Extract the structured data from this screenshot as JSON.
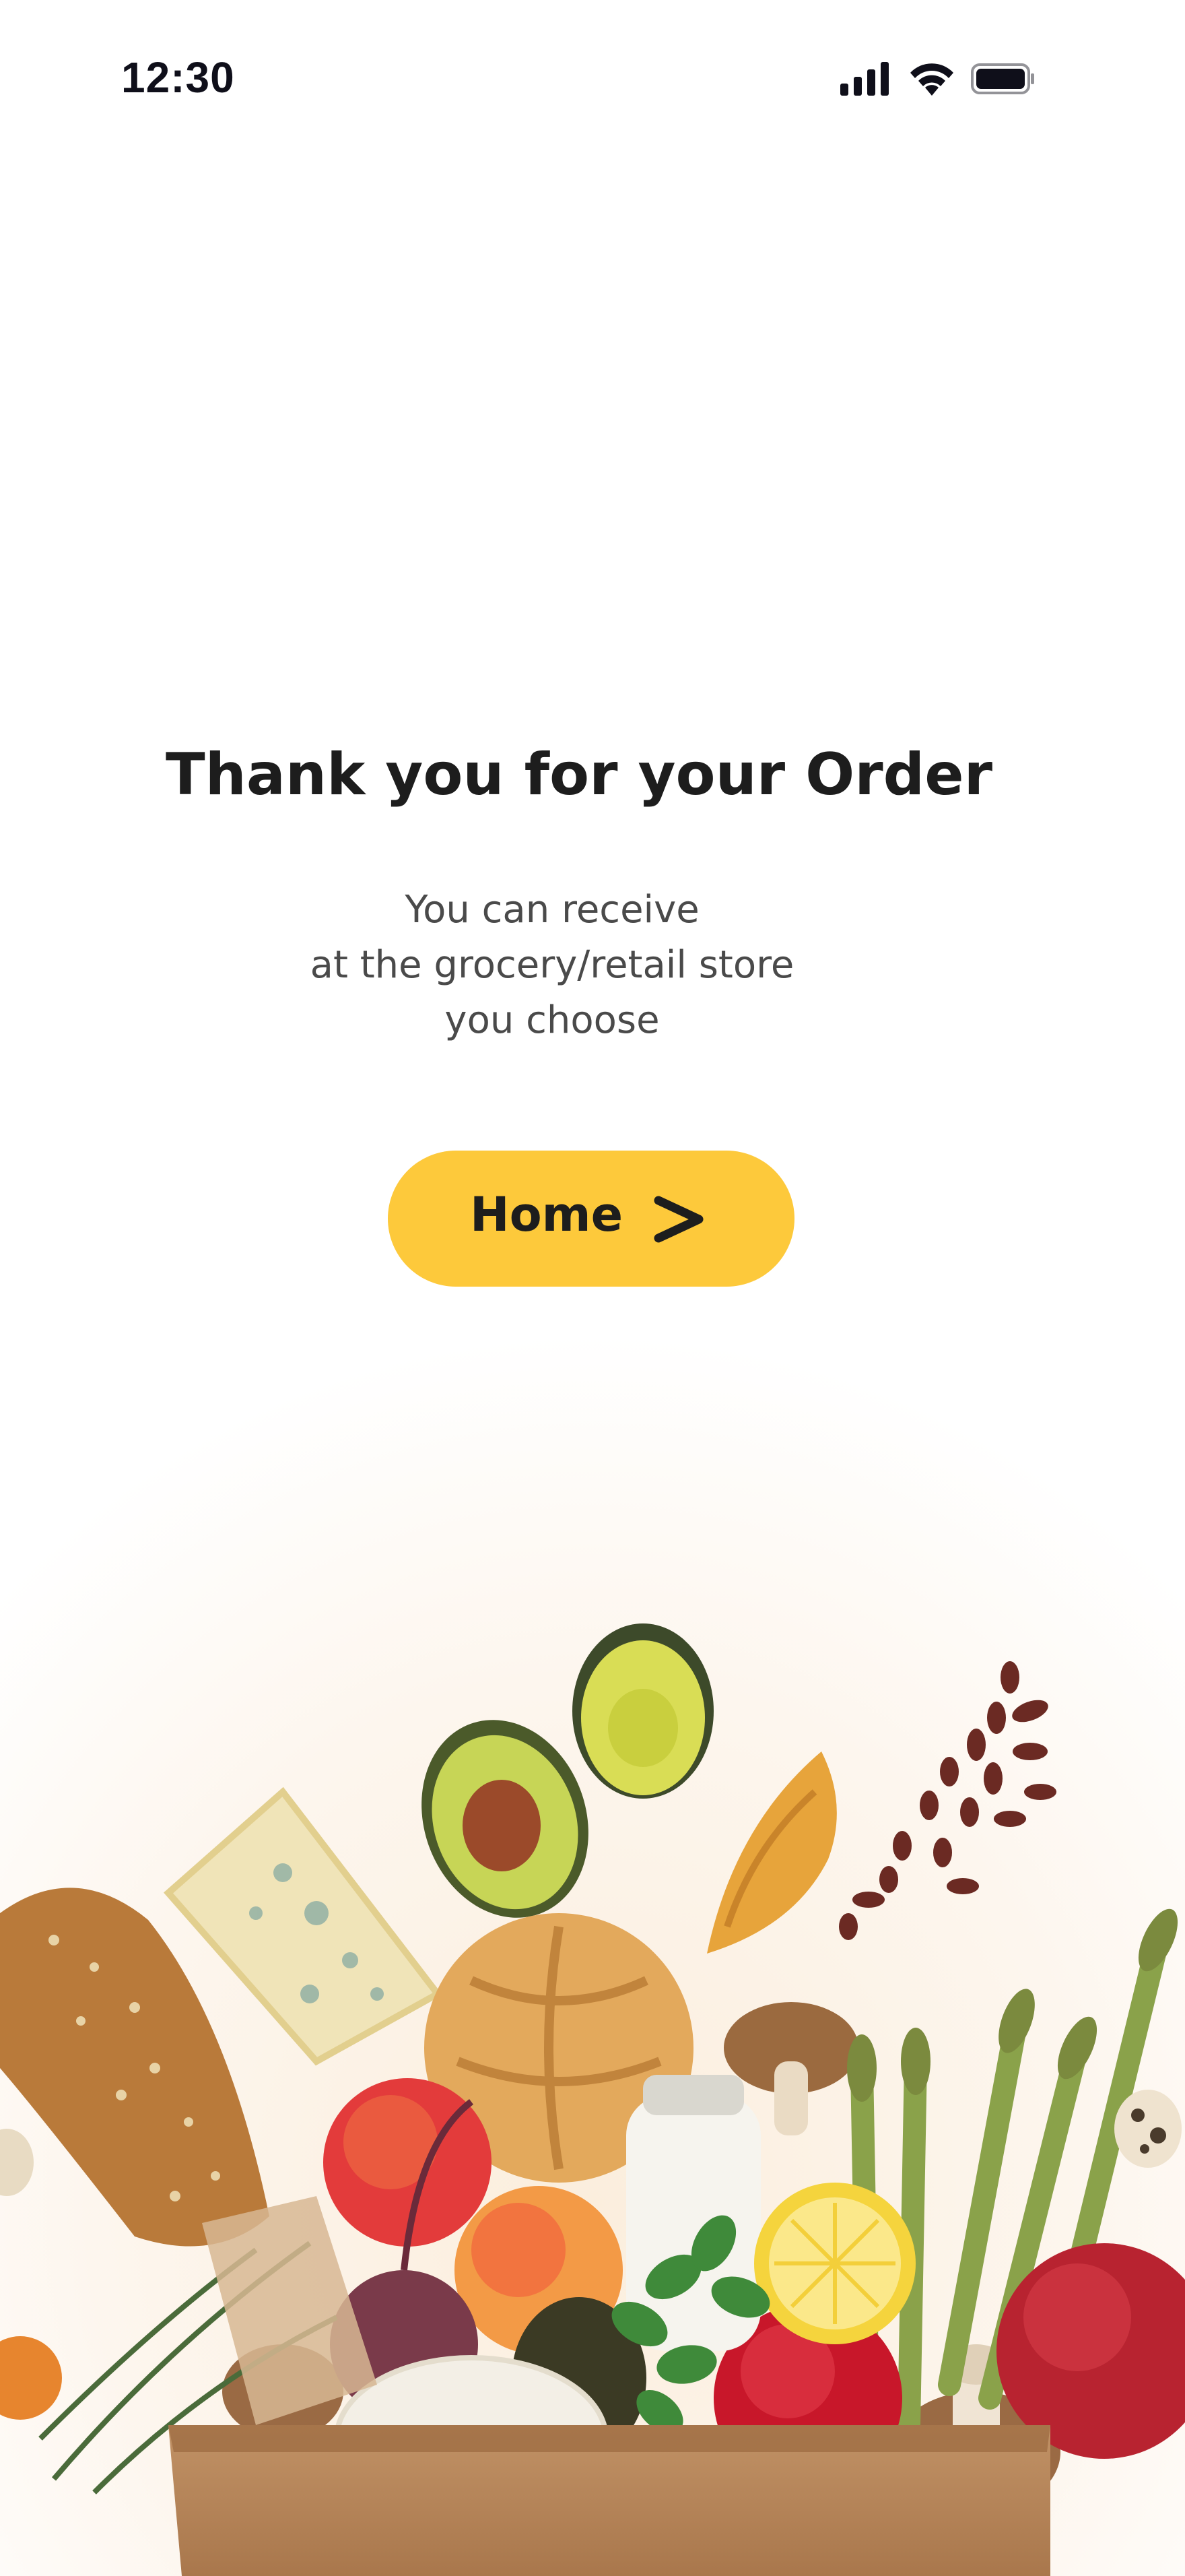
{
  "status_bar": {
    "time": "12:30",
    "icons": [
      "signal-icon",
      "wifi-icon",
      "battery-icon"
    ]
  },
  "confirmation": {
    "title": "Thank you for your Order",
    "message_lines": [
      "You can receive",
      "at the grocery/retail store",
      "you choose"
    ]
  },
  "home_button": {
    "label": "Home",
    "icon": "chevron-right-icon"
  },
  "illustration": {
    "name": "grocery-bag-image"
  },
  "colors": {
    "accent": "#fdc93b",
    "title_text": "#1d1d1d",
    "body_text": "#4a4a4a",
    "background": "#ffffff"
  }
}
